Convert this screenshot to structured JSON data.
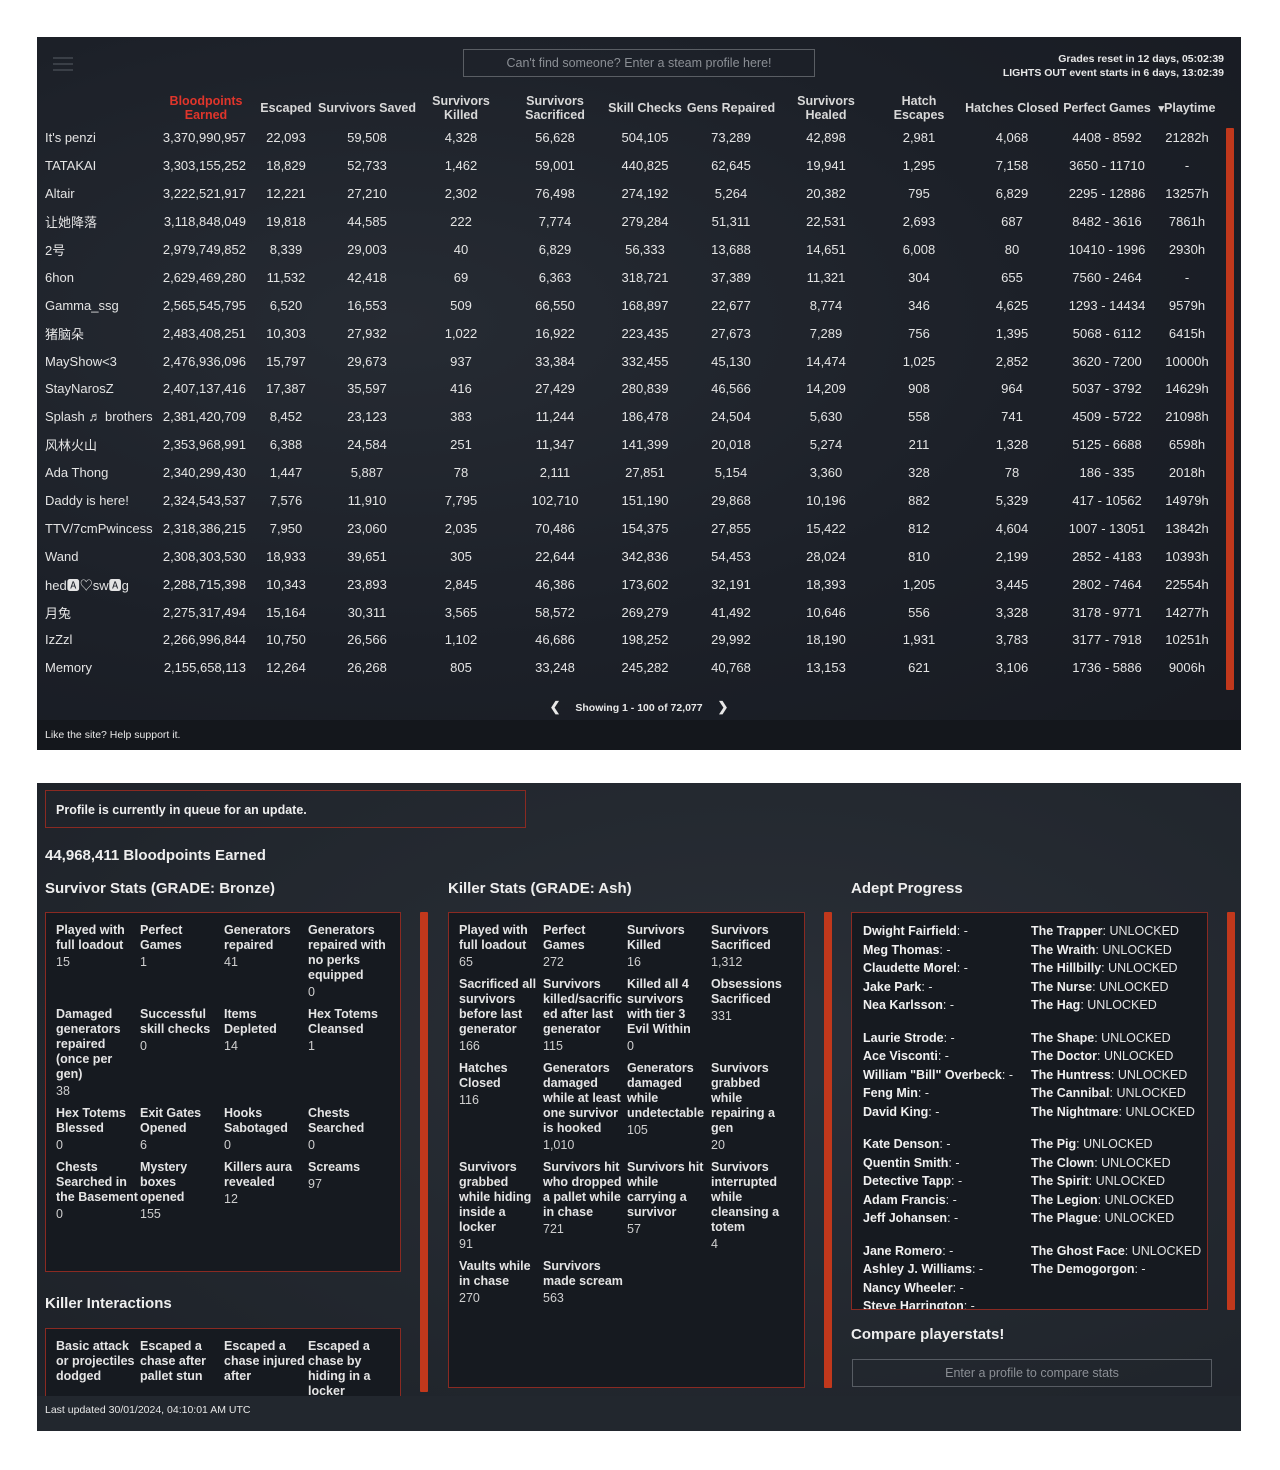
{
  "header": {
    "search_placeholder": "Can't find someone? Enter a steam profile here!",
    "grades_reset": "Grades reset in 12 days, 05:02:39",
    "event_timer": "LIGHTS OUT event starts in 6 days, 13:02:39"
  },
  "leaderboard": {
    "columns": [
      "",
      "Bloodpoints Earned",
      "Escaped",
      "Survivors Saved",
      "Survivors Killed",
      "Survivors Sacrificed",
      "Skill Checks",
      "Gens Repaired",
      "Survivors Healed",
      "Hatch Escapes",
      "Hatches Closed",
      "Perfect Games",
      "Playtime"
    ],
    "sorted_column": "Bloodpoints Earned",
    "sort_icon": "caret-down-icon",
    "rows": [
      [
        "It's penzi",
        "3,370,990,957",
        "22,093",
        "59,508",
        "4,328",
        "56,628",
        "504,105",
        "73,289",
        "42,898",
        "2,981",
        "4,068",
        "4408 - 8592",
        "21282h"
      ],
      [
        "TATAKAI",
        "3,303,155,252",
        "18,829",
        "52,733",
        "1,462",
        "59,001",
        "440,825",
        "62,645",
        "19,941",
        "1,295",
        "7,158",
        "3650 - 11710",
        "-"
      ],
      [
        "Altair",
        "3,222,521,917",
        "12,221",
        "27,210",
        "2,302",
        "76,498",
        "274,192",
        "5,264",
        "20,382",
        "795",
        "6,829",
        "2295 - 12886",
        "13257h"
      ],
      [
        "让她降落",
        "3,118,848,049",
        "19,818",
        "44,585",
        "222",
        "7,774",
        "279,284",
        "51,311",
        "22,531",
        "2,693",
        "687",
        "8482 - 3616",
        "7861h"
      ],
      [
        "2号",
        "2,979,749,852",
        "8,339",
        "29,003",
        "40",
        "6,829",
        "56,333",
        "13,688",
        "14,651",
        "6,008",
        "80",
        "10410 - 1996",
        "2930h"
      ],
      [
        "6hon",
        "2,629,469,280",
        "11,532",
        "42,418",
        "69",
        "6,363",
        "318,721",
        "37,389",
        "11,321",
        "304",
        "655",
        "7560 - 2464",
        "-"
      ],
      [
        "Gamma_ssg",
        "2,565,545,795",
        "6,520",
        "16,553",
        "509",
        "66,550",
        "168,897",
        "22,677",
        "8,774",
        "346",
        "4,625",
        "1293 - 14434",
        "9579h"
      ],
      [
        "猪脑朵",
        "2,483,408,251",
        "10,303",
        "27,932",
        "1,022",
        "16,922",
        "223,435",
        "27,673",
        "7,289",
        "756",
        "1,395",
        "5068 - 6112",
        "6415h"
      ],
      [
        "MayShow<3",
        "2,476,936,096",
        "15,797",
        "29,673",
        "937",
        "33,384",
        "332,455",
        "45,130",
        "14,474",
        "1,025",
        "2,852",
        "3620 - 7200",
        "10000h"
      ],
      [
        "StayNarosZ",
        "2,407,137,416",
        "17,387",
        "35,597",
        "416",
        "27,429",
        "280,839",
        "46,566",
        "14,209",
        "908",
        "964",
        "5037 - 3792",
        "14629h"
      ],
      [
        "Splash ♬ brothers",
        "2,381,420,709",
        "8,452",
        "23,123",
        "383",
        "11,244",
        "186,478",
        "24,504",
        "5,630",
        "558",
        "741",
        "4509 - 5722",
        "21098h"
      ],
      [
        "风林火山",
        "2,353,968,991",
        "6,388",
        "24,584",
        "251",
        "11,347",
        "141,399",
        "20,018",
        "5,274",
        "211",
        "1,328",
        "5125 - 6688",
        "6598h"
      ],
      [
        "Ada Thong",
        "2,340,299,430",
        "1,447",
        "5,887",
        "78",
        "2,111",
        "27,851",
        "5,154",
        "3,360",
        "328",
        "78",
        "186 - 335",
        "2018h"
      ],
      [
        "Daddy is here!",
        "2,324,543,537",
        "7,576",
        "11,910",
        "7,795",
        "102,710",
        "151,190",
        "29,868",
        "10,196",
        "882",
        "5,329",
        "417 - 10562",
        "14979h"
      ],
      [
        "TTV/7cmPwincess",
        "2,318,386,215",
        "7,950",
        "23,060",
        "2,035",
        "70,486",
        "154,375",
        "27,855",
        "15,422",
        "812",
        "4,604",
        "1007 - 13051",
        "13842h"
      ],
      [
        "Wand",
        "2,308,303,530",
        "18,933",
        "39,651",
        "305",
        "22,644",
        "342,836",
        "54,453",
        "28,024",
        "810",
        "2,199",
        "2852 - 4183",
        "10393h"
      ],
      [
        "hed🅰♡sw🅰g",
        "2,288,715,398",
        "10,343",
        "23,893",
        "2,845",
        "46,386",
        "173,602",
        "32,191",
        "18,393",
        "1,205",
        "3,445",
        "2802 - 7464",
        "22554h"
      ],
      [
        "月兔",
        "2,275,317,494",
        "15,164",
        "30,311",
        "3,565",
        "58,572",
        "269,279",
        "41,492",
        "10,646",
        "556",
        "3,328",
        "3178 - 9771",
        "14277h"
      ],
      [
        "IzZzl",
        "2,266,996,844",
        "10,750",
        "26,566",
        "1,102",
        "46,686",
        "198,252",
        "29,992",
        "18,190",
        "1,931",
        "3,783",
        "3177 - 7918",
        "10251h"
      ],
      [
        "Memory",
        "2,155,658,113",
        "12,264",
        "26,268",
        "805",
        "33,248",
        "245,282",
        "40,768",
        "13,153",
        "621",
        "3,106",
        "1736 - 5886",
        "9006h"
      ]
    ],
    "pagination": {
      "prev_icon": "chevron-left-icon",
      "text": "Showing 1 - 100 of 72,077",
      "next_icon": "chevron-right-icon"
    },
    "footer": "Like the site? Help support it."
  },
  "profile": {
    "notice": "Profile is currently in queue for an update.",
    "bloodpoints": "44,968,411 Bloodpoints Earned",
    "survivor": {
      "title": "Survivor Stats (GRADE: Bronze)",
      "stats": [
        [
          "Played with full loadout",
          "15"
        ],
        [
          "Perfect Games",
          "1"
        ],
        [
          "Generators repaired",
          "41"
        ],
        [
          "Generators repaired with no perks equipped",
          "0"
        ],
        [
          "Damaged generators repaired (once per gen)",
          "38"
        ],
        [
          "Successful skill checks",
          "0"
        ],
        [
          "Items Depleted",
          "14"
        ],
        [
          "Hex Totems Cleansed",
          "1"
        ],
        [
          "Hex Totems Blessed",
          "0"
        ],
        [
          "Exit Gates Opened",
          "6"
        ],
        [
          "Hooks Sabotaged",
          "0"
        ],
        [
          "Chests Searched",
          "0"
        ],
        [
          "Chests Searched in the Basement",
          "0"
        ],
        [
          "Mystery boxes opened",
          "155"
        ],
        [
          "Killers aura revealed",
          "12"
        ],
        [
          "Screams",
          "97"
        ]
      ]
    },
    "killer_interactions": {
      "title": "Killer Interactions",
      "stats": [
        [
          "Basic attack or projectiles dodged",
          ""
        ],
        [
          "Escaped a chase after pallet stun",
          ""
        ],
        [
          "Escaped a chase injured after",
          ""
        ],
        [
          "Escaped a chase by hiding in a locker",
          ""
        ]
      ]
    },
    "killer": {
      "title": "Killer Stats (GRADE: Ash)",
      "stats": [
        [
          "Played with full loadout",
          "65"
        ],
        [
          "Perfect Games",
          "272"
        ],
        [
          "Survivors Killed",
          "16"
        ],
        [
          "Survivors Sacrificed",
          "1,312"
        ],
        [
          "Sacrificed all survivors before last generator",
          "166"
        ],
        [
          "Survivors killed/sacrificed after last generator",
          "115"
        ],
        [
          "Killed all 4 survivors with tier 3 Evil Within",
          "0"
        ],
        [
          "Obsessions Sacrificed",
          "331"
        ],
        [
          "Hatches Closed",
          "116"
        ],
        [
          "Generators damaged while at least one survivor is hooked",
          "1,010"
        ],
        [
          "Generators damaged while undetectable",
          "105"
        ],
        [
          "Survivors grabbed while repairing a gen",
          "20"
        ],
        [
          "Survivors grabbed while hiding inside a locker",
          "91"
        ],
        [
          "Survivors hit who dropped a pallet while in chase",
          "721"
        ],
        [
          "Survivors hit while carrying a survivor",
          "57"
        ],
        [
          "Survivors interrupted while cleansing a totem",
          "4"
        ],
        [
          "Vaults while in chase",
          "270"
        ],
        [
          "Survivors made scream",
          "563"
        ]
      ]
    },
    "adept": {
      "title": "Adept Progress",
      "survivors": [
        [
          [
            "Dwight Fairfield",
            "-"
          ],
          [
            "Meg Thomas",
            "-"
          ],
          [
            "Claudette Morel",
            "-"
          ],
          [
            "Jake Park",
            "-"
          ],
          [
            "Nea Karlsson",
            "-"
          ]
        ],
        [
          [
            "Laurie Strode",
            "-"
          ],
          [
            "Ace Visconti",
            "-"
          ],
          [
            "William \"Bill\" Overbeck",
            "-"
          ],
          [
            "Feng Min",
            "-"
          ],
          [
            "David King",
            "-"
          ]
        ],
        [
          [
            "Kate Denson",
            "-"
          ],
          [
            "Quentin Smith",
            "-"
          ],
          [
            "Detective Tapp",
            "-"
          ],
          [
            "Adam Francis",
            "-"
          ],
          [
            "Jeff Johansen",
            "-"
          ]
        ],
        [
          [
            "Jane Romero",
            "-"
          ],
          [
            "Ashley J. Williams",
            "-"
          ],
          [
            "Nancy Wheeler",
            "-"
          ],
          [
            "Steve Harrington",
            "-"
          ]
        ]
      ],
      "killers": [
        [
          [
            "The Trapper",
            "UNLOCKED"
          ],
          [
            "The Wraith",
            "UNLOCKED"
          ],
          [
            "The Hillbilly",
            "UNLOCKED"
          ],
          [
            "The Nurse",
            "UNLOCKED"
          ],
          [
            "The Hag",
            "UNLOCKED"
          ]
        ],
        [
          [
            "The Shape",
            "UNLOCKED"
          ],
          [
            "The Doctor",
            "UNLOCKED"
          ],
          [
            "The Huntress",
            "UNLOCKED"
          ],
          [
            "The Cannibal",
            "UNLOCKED"
          ],
          [
            "The Nightmare",
            "UNLOCKED"
          ]
        ],
        [
          [
            "The Pig",
            "UNLOCKED"
          ],
          [
            "The Clown",
            "UNLOCKED"
          ],
          [
            "The Spirit",
            "UNLOCKED"
          ],
          [
            "The Legion",
            "UNLOCKED"
          ],
          [
            "The Plague",
            "UNLOCKED"
          ]
        ],
        [
          [
            "The Ghost Face",
            "UNLOCKED"
          ],
          [
            "The Demogorgon",
            "-"
          ]
        ]
      ]
    },
    "compare": {
      "title": "Compare playerstats!",
      "placeholder": "Enter a profile to compare stats"
    },
    "last_updated": "Last updated 30/01/2024, 04:10:01 AM UTC"
  },
  "colors": {
    "accent": "#e0352b",
    "border": "#8a2a22",
    "scrollbar": "#c1381c",
    "background": "#1c2028"
  }
}
